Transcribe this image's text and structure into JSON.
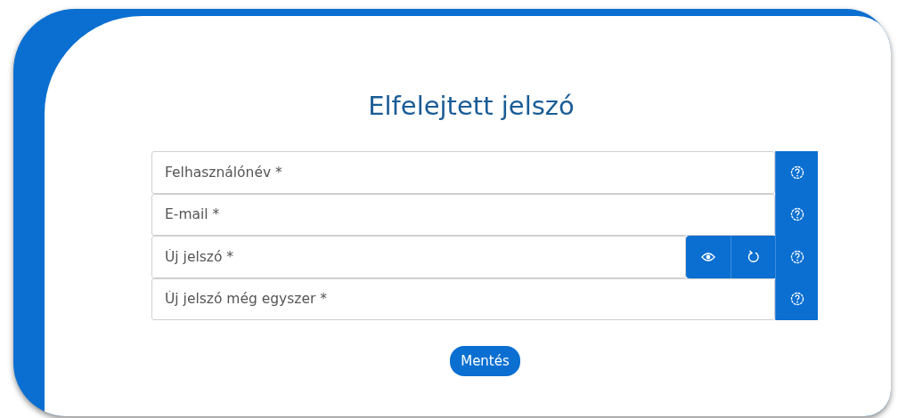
{
  "title": "Elfelejtett jelszó",
  "fields": [
    {
      "kind": "text",
      "placeholder": "Felhasználónév *"
    },
    {
      "kind": "text",
      "placeholder": "E-mail *"
    },
    {
      "kind": "password",
      "placeholder": "Új jelszó *"
    },
    {
      "kind": "password-confirm",
      "placeholder": "Új jelszó még egyszer *"
    }
  ],
  "submit": "Mentés"
}
